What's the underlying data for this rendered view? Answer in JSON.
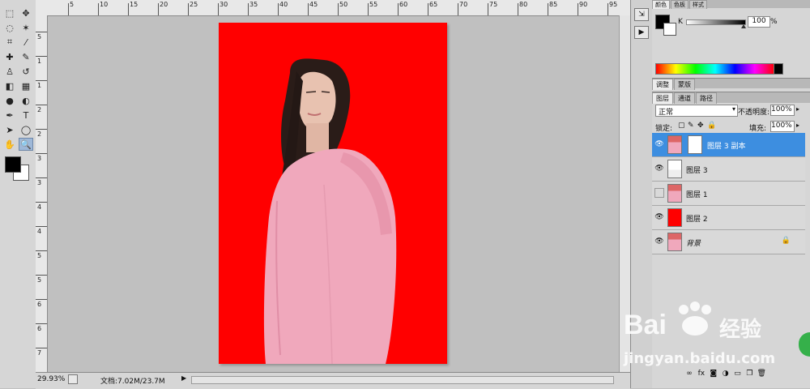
{
  "toolbar": {
    "tools": [
      {
        "name": "marquee-tool",
        "glyph": "⬚"
      },
      {
        "name": "move-tool",
        "glyph": "✥"
      },
      {
        "name": "lasso-tool",
        "glyph": "◌"
      },
      {
        "name": "magic-wand-tool",
        "glyph": "✶"
      },
      {
        "name": "crop-tool",
        "glyph": "⌗"
      },
      {
        "name": "eyedropper-tool",
        "glyph": "⁄"
      },
      {
        "name": "healing-brush-tool",
        "glyph": "✚"
      },
      {
        "name": "brush-tool",
        "glyph": "✎"
      },
      {
        "name": "clone-stamp-tool",
        "glyph": "♙"
      },
      {
        "name": "history-brush-tool",
        "glyph": "↺"
      },
      {
        "name": "eraser-tool",
        "glyph": "◧"
      },
      {
        "name": "gradient-tool",
        "glyph": "▦"
      },
      {
        "name": "blur-tool",
        "glyph": "●"
      },
      {
        "name": "dodge-tool",
        "glyph": "◐"
      },
      {
        "name": "pen-tool",
        "glyph": "✒"
      },
      {
        "name": "type-tool",
        "glyph": "T"
      },
      {
        "name": "path-selection-tool",
        "glyph": "➤"
      },
      {
        "name": "shape-tool",
        "glyph": "◯"
      },
      {
        "name": "hand-tool",
        "glyph": "✋"
      },
      {
        "name": "zoom-tool",
        "glyph": "🔍"
      }
    ],
    "foreground_color": "#000000",
    "background_color": "#ffffff"
  },
  "ruler": {
    "top_labels": [
      "5",
      "10",
      "15",
      "20",
      "25",
      "30",
      "35",
      "40",
      "45",
      "50",
      "55",
      "60",
      "65",
      "70",
      "75",
      "80",
      "85",
      "90",
      "95"
    ],
    "left_labels": [
      "5",
      "1",
      "1",
      "2",
      "2",
      "3",
      "3",
      "4",
      "4",
      "5",
      "5",
      "6",
      "6",
      "7"
    ]
  },
  "status": {
    "zoom": "29.93%",
    "doc_info": "文档:7.02M/23.7M"
  },
  "color_panel": {
    "channel_label": "K",
    "value": "100",
    "unit": "%"
  },
  "adjust_tabs": [
    "调整",
    "蒙版"
  ],
  "layer_tabs": [
    "图层",
    "通道",
    "路径"
  ],
  "layers_panel": {
    "blend_mode": "正常",
    "opacity_label": "不透明度:",
    "opacity_value": "100%",
    "lock_label": "锁定:",
    "fill_label": "填充:",
    "fill_value": "100%"
  },
  "layers": [
    {
      "name": "图层 3 副本",
      "visible": true,
      "selected": true,
      "thumb": "person",
      "mask": true
    },
    {
      "name": "图层 3",
      "visible": true,
      "selected": false,
      "thumb": "person-white",
      "mask": false
    },
    {
      "name": "图层 1",
      "visible": false,
      "selected": false,
      "thumb": "person-pink",
      "mask": false
    },
    {
      "name": "图层 2",
      "visible": true,
      "selected": false,
      "thumb": "red",
      "mask": false
    },
    {
      "name": "背景",
      "visible": true,
      "selected": false,
      "thumb": "person-pink",
      "mask": false,
      "locked": true
    }
  ],
  "watermark": {
    "brand": "Bai",
    "brand_cn": "经验",
    "url": "jingyan.baidu.com"
  },
  "colors": {
    "doc_background": "#ff0000",
    "coat": "#f0a8bc",
    "selection": "#3d8ee0"
  }
}
